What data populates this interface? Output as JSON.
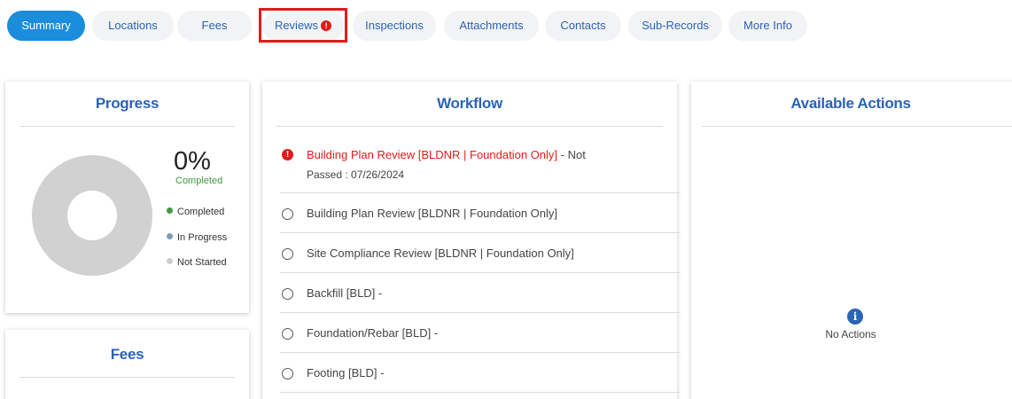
{
  "tabs": [
    {
      "label": "Summary",
      "active": true
    },
    {
      "label": "Locations"
    },
    {
      "label": "Fees"
    },
    {
      "label": "Reviews",
      "alert": "!"
    },
    {
      "label": "Inspections"
    },
    {
      "label": "Attachments"
    },
    {
      "label": "Contacts"
    },
    {
      "label": "Sub-Records"
    },
    {
      "label": "More Info"
    }
  ],
  "progress": {
    "title": "Progress",
    "percent": "0%",
    "percent_label": "Completed",
    "legend": [
      {
        "label": "Completed",
        "color": "#3f9a3f"
      },
      {
        "label": "In Progress",
        "color": "#7f9cb5"
      },
      {
        "label": "Not Started",
        "color": "#cccccc"
      }
    ]
  },
  "fees": {
    "title": "Fees"
  },
  "workflow": {
    "title": "Workflow",
    "items": [
      {
        "name": "Building Plan Review [BLDNR | Foundation Only]",
        "status_line1": " - Not",
        "status_line2": "Passed : 07/26/2024",
        "state": "failed"
      },
      {
        "name": "Building Plan Review [BLDNR | Foundation Only]",
        "state": "pending"
      },
      {
        "name": "Site Compliance Review [BLDNR | Foundation Only]",
        "state": "pending"
      },
      {
        "name": "Backfill [BLD] -",
        "state": "pending"
      },
      {
        "name": "Foundation/Rebar [BLD] -",
        "state": "pending"
      },
      {
        "name": "Footing [BLD] -",
        "state": "pending"
      }
    ]
  },
  "actions": {
    "title": "Available Actions",
    "empty_text": "No Actions",
    "empty_icon": "i"
  },
  "colors": {
    "accent": "#1a8ddb",
    "link": "#2b63b5",
    "alert": "#e01b1b"
  }
}
